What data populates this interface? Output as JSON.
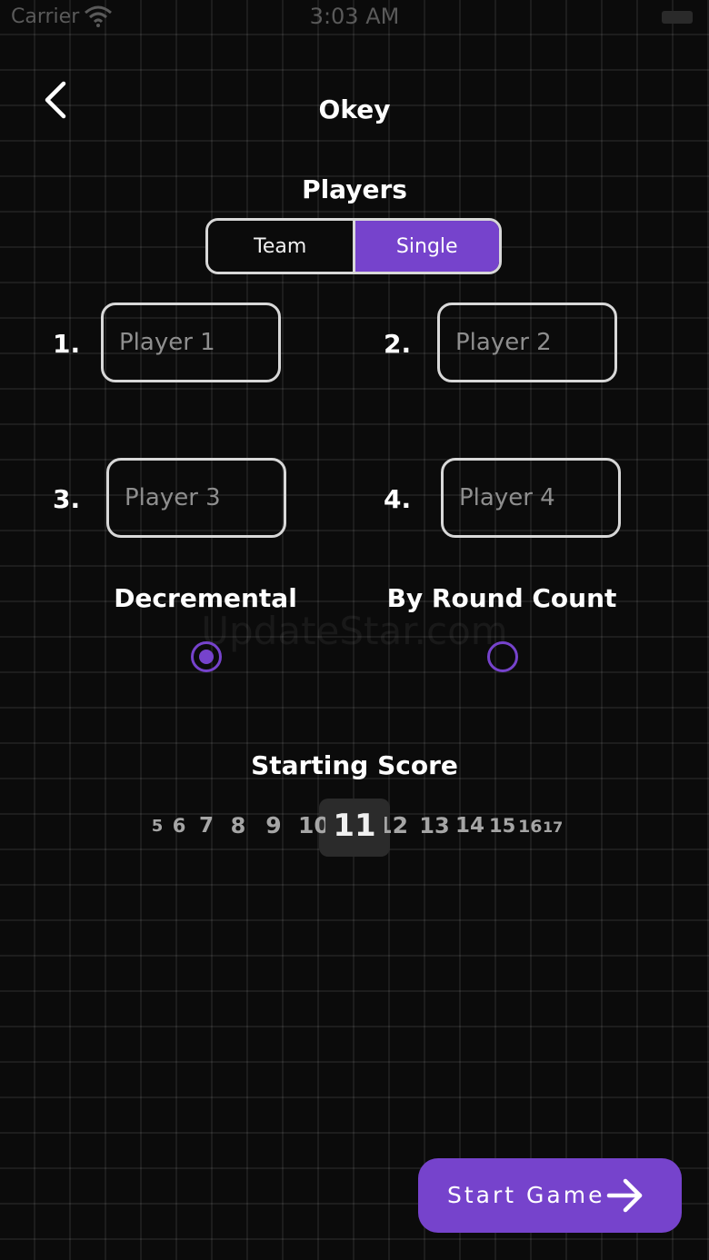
{
  "status_bar": {
    "carrier": "Carrier",
    "time": "3:03 AM"
  },
  "header": {
    "title": "Okey",
    "back_icon": "chevron-left-icon"
  },
  "players": {
    "title": "Players",
    "tabs": [
      {
        "label": "Team",
        "selected": false
      },
      {
        "label": "Single",
        "selected": true
      }
    ],
    "fields": [
      {
        "number": "1.",
        "placeholder": "Player 1",
        "value": ""
      },
      {
        "number": "2.",
        "placeholder": "Player 2",
        "value": ""
      },
      {
        "number": "3.",
        "placeholder": "Player 3",
        "value": ""
      },
      {
        "number": "4.",
        "placeholder": "Player 4",
        "value": ""
      }
    ]
  },
  "game_mode": {
    "options": [
      {
        "label": "Decremental",
        "selected": true
      },
      {
        "label": "By Round Count",
        "selected": false
      }
    ]
  },
  "watermark": "UpdateStar.com",
  "starting_score": {
    "title": "Starting Score",
    "values": [
      "5",
      "6",
      "7",
      "8",
      "9",
      "10",
      "11",
      "12",
      "13",
      "14",
      "15",
      "16",
      "17"
    ],
    "selected": "11"
  },
  "start_button": {
    "label": "Start Game",
    "icon": "arrow-right-icon"
  },
  "colors": {
    "accent": "#7643cc",
    "background": "#0b0b0b",
    "border": "#d8d8d8"
  }
}
